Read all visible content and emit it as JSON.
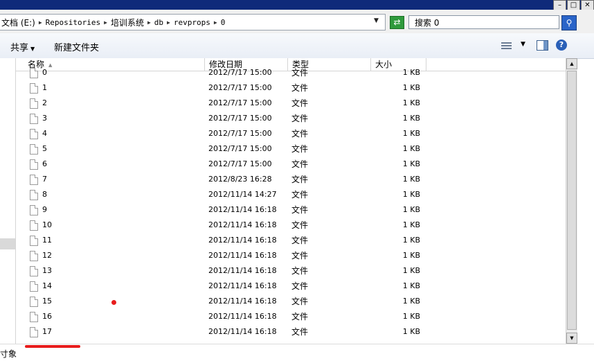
{
  "address": {
    "segments": [
      "文档 (E:)",
      "Repositories",
      "培训系统",
      "db",
      "revprops",
      "0"
    ]
  },
  "search": {
    "placeholder": "搜索 0"
  },
  "toolbar": {
    "share_label": "共享",
    "new_folder_label": "新建文件夹"
  },
  "columns": {
    "name": "名称",
    "date": "修改日期",
    "type": "类型",
    "size": "大小"
  },
  "files": [
    {
      "name": "0",
      "date": "2012/7/17 15:00",
      "type": "文件",
      "size": "1 KB"
    },
    {
      "name": "1",
      "date": "2012/7/17 15:00",
      "type": "文件",
      "size": "1 KB"
    },
    {
      "name": "2",
      "date": "2012/7/17 15:00",
      "type": "文件",
      "size": "1 KB"
    },
    {
      "name": "3",
      "date": "2012/7/17 15:00",
      "type": "文件",
      "size": "1 KB"
    },
    {
      "name": "4",
      "date": "2012/7/17 15:00",
      "type": "文件",
      "size": "1 KB"
    },
    {
      "name": "5",
      "date": "2012/7/17 15:00",
      "type": "文件",
      "size": "1 KB"
    },
    {
      "name": "6",
      "date": "2012/7/17 15:00",
      "type": "文件",
      "size": "1 KB"
    },
    {
      "name": "7",
      "date": "2012/8/23 16:28",
      "type": "文件",
      "size": "1 KB"
    },
    {
      "name": "8",
      "date": "2012/11/14 14:27",
      "type": "文件",
      "size": "1 KB"
    },
    {
      "name": "9",
      "date": "2012/11/14 16:18",
      "type": "文件",
      "size": "1 KB"
    },
    {
      "name": "10",
      "date": "2012/11/14 16:18",
      "type": "文件",
      "size": "1 KB"
    },
    {
      "name": "11",
      "date": "2012/11/14 16:18",
      "type": "文件",
      "size": "1 KB"
    },
    {
      "name": "12",
      "date": "2012/11/14 16:18",
      "type": "文件",
      "size": "1 KB"
    },
    {
      "name": "13",
      "date": "2012/11/14 16:18",
      "type": "文件",
      "size": "1 KB"
    },
    {
      "name": "14",
      "date": "2012/11/14 16:18",
      "type": "文件",
      "size": "1 KB"
    },
    {
      "name": "15",
      "date": "2012/11/14 16:18",
      "type": "文件",
      "size": "1 KB"
    },
    {
      "name": "16",
      "date": "2012/11/14 16:18",
      "type": "文件",
      "size": "1 KB"
    },
    {
      "name": "17",
      "date": "2012/11/14 16:18",
      "type": "文件",
      "size": "1 KB"
    }
  ],
  "status": {
    "text": "寸象"
  },
  "colors": {
    "titlebar": "#0f2a7a",
    "refresh": "#2f9a3c",
    "annotation": "#e81c1c"
  },
  "icons": [
    "minimize-icon",
    "maximize-icon",
    "close-icon",
    "chevron-down-icon",
    "refresh-icon",
    "search-icon",
    "view-list-icon",
    "preview-pane-icon",
    "help-icon",
    "file-icon"
  ]
}
